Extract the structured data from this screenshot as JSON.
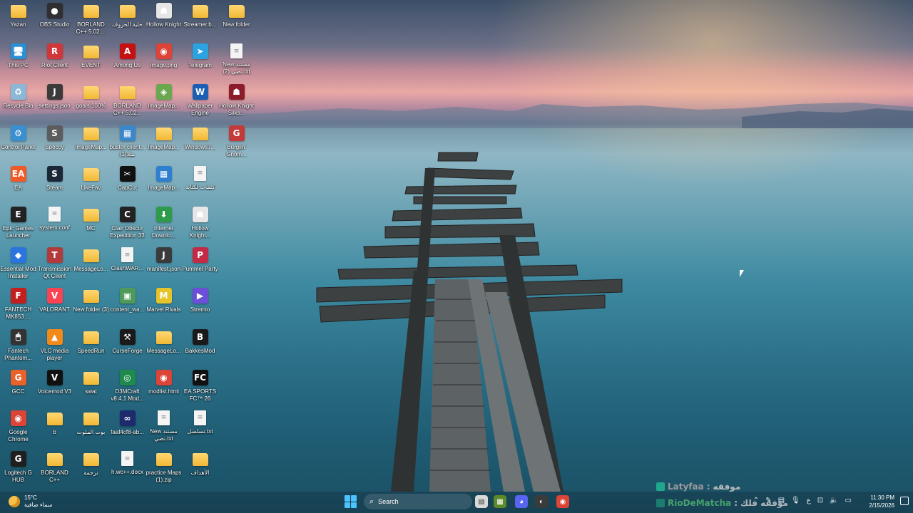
{
  "desktop": {
    "icons": [
      {
        "label": "Yazan",
        "kind": "folder"
      },
      {
        "label": "This PC",
        "kind": "app",
        "color": "#2b8fd6",
        "glyph": "🖥"
      },
      {
        "label": "Recycle Bin",
        "kind": "app",
        "color": "#8cb7d6",
        "glyph": "♻"
      },
      {
        "label": "Control Panel",
        "kind": "app",
        "color": "#3a8fd0",
        "glyph": "⚙"
      },
      {
        "label": "EA",
        "kind": "app",
        "color": "#f05a28",
        "glyph": "EA"
      },
      {
        "label": "Epic Games Launcher",
        "kind": "app",
        "color": "#222222",
        "glyph": "E"
      },
      {
        "label": "Essential Mod Installer",
        "kind": "app",
        "color": "#2a74e0",
        "glyph": "◆"
      },
      {
        "label": "FANTECH MK853 ...",
        "kind": "app",
        "color": "#c41f1f",
        "glyph": "F"
      },
      {
        "label": "Fantech Phantom...",
        "kind": "app",
        "color": "#333333",
        "glyph": "🖱"
      },
      {
        "label": "GCC",
        "kind": "app",
        "color": "#e8622a",
        "glyph": "G"
      },
      {
        "label": "Google Chrome",
        "kind": "app",
        "color": "#db4437",
        "glyph": "◉"
      },
      {
        "label": "Logitech G HUB",
        "kind": "app",
        "color": "#1f1f1f",
        "glyph": "G"
      },
      {
        "label": "OBS Studio",
        "kind": "app",
        "color": "#302e31",
        "glyph": "●"
      },
      {
        "label": "Riot Client",
        "kind": "app",
        "color": "#d13639",
        "glyph": "R"
      },
      {
        "label": "settings.json",
        "kind": "app",
        "color": "#3b3b3b",
        "glyph": "J"
      },
      {
        "label": "Speccy",
        "kind": "app",
        "color": "#5c5c5c",
        "glyph": "S"
      },
      {
        "label": "Steam",
        "kind": "app",
        "color": "#1b2838",
        "glyph": "S"
      },
      {
        "label": "system.conf",
        "kind": "file"
      },
      {
        "label": "Transmission Qt Client",
        "kind": "app",
        "color": "#b23a3a",
        "glyph": "T"
      },
      {
        "label": "VALORANT",
        "kind": "app",
        "color": "#fa4454",
        "glyph": "V"
      },
      {
        "label": "VLC media player",
        "kind": "app",
        "color": "#f28a1a",
        "glyph": "▲"
      },
      {
        "label": "Voicemod V3",
        "kind": "app",
        "color": "#111111",
        "glyph": "V"
      },
      {
        "label": "b",
        "kind": "folder"
      },
      {
        "label": "BORLAND C++",
        "kind": "folder"
      },
      {
        "label": "BORLAND C++ 5.02 ...",
        "kind": "folder"
      },
      {
        "label": "EVENT",
        "kind": "folder"
      },
      {
        "label": "goals 100%",
        "kind": "folder"
      },
      {
        "label": "ImageMap...",
        "kind": "folder"
      },
      {
        "label": "LikeFav",
        "kind": "folder"
      },
      {
        "label": "MC",
        "kind": "folder"
      },
      {
        "label": "MessageLo...",
        "kind": "folder"
      },
      {
        "label": "New folder (3)",
        "kind": "folder"
      },
      {
        "label": "SpeedRun",
        "kind": "folder"
      },
      {
        "label": "swat",
        "kind": "folder"
      },
      {
        "label": "بوت الملوت",
        "kind": "folder"
      },
      {
        "label": "ترجمة",
        "kind": "folder"
      },
      {
        "label": "خلية الحروف",
        "kind": "folder"
      },
      {
        "label": "Among Us",
        "kind": "app",
        "color": "#c51111",
        "glyph": "A"
      },
      {
        "label": "BORLAND C++ 5.02...",
        "kind": "folder"
      },
      {
        "label": "buster client... مثلا(1)",
        "kind": "app",
        "color": "#3a87c9",
        "glyph": "▦"
      },
      {
        "label": "CapCut",
        "kind": "app",
        "color": "#111111",
        "glyph": "✂"
      },
      {
        "label": "Clair Obscur Expedition 33",
        "kind": "app",
        "color": "#222222",
        "glyph": "C"
      },
      {
        "label": "ClashWAR...",
        "kind": "file"
      },
      {
        "label": "content_wa...",
        "kind": "app",
        "color": "#4e9a59",
        "glyph": "▣"
      },
      {
        "label": "CurseForge",
        "kind": "app",
        "color": "#1a1a1a",
        "glyph": "⚒"
      },
      {
        "label": "D3MCraft v8.4.1 Mod...",
        "kind": "app",
        "color": "#1e8a4c",
        "glyph": "◎"
      },
      {
        "label": "faaf4cf8-ab...",
        "kind": "app",
        "color": "#1d2a6b",
        "glyph": "∞"
      },
      {
        "label": "h.wc++.docx",
        "kind": "file"
      },
      {
        "label": "Hollow Knight",
        "kind": "app",
        "color": "#e6e6e6",
        "glyph": "☗"
      },
      {
        "label": "image.png",
        "kind": "app",
        "color": "#db4437",
        "glyph": "◉"
      },
      {
        "label": "ImageMap...",
        "kind": "app",
        "color": "#6aa84f",
        "glyph": "◈"
      },
      {
        "label": "ImageMap...",
        "kind": "folder"
      },
      {
        "label": "ImageMap...",
        "kind": "app",
        "color": "#2f7fd0",
        "glyph": "▦"
      },
      {
        "label": "Internet Downlo...",
        "kind": "app",
        "color": "#2f9a4a",
        "glyph": "⬇"
      },
      {
        "label": "manifest.json",
        "kind": "app",
        "color": "#3b3b3b",
        "glyph": "J"
      },
      {
        "label": "Marvel Rivals",
        "kind": "app",
        "color": "#e5c42a",
        "glyph": "M"
      },
      {
        "label": "MessageLo...",
        "kind": "folder"
      },
      {
        "label": "modlist.html",
        "kind": "app",
        "color": "#db4437",
        "glyph": "◉"
      },
      {
        "label": "New مستند نصي.txt",
        "kind": "file"
      },
      {
        "label": "practice Maps (1).zip",
        "kind": "folder"
      },
      {
        "label": "Streamer.b...",
        "kind": "folder"
      },
      {
        "label": "Telegram",
        "kind": "app",
        "color": "#2aa3e0",
        "glyph": "➤"
      },
      {
        "label": "Wallpaper Engine",
        "kind": "app",
        "color": "#1a5fb4",
        "glyph": "W"
      },
      {
        "label": "Windows7...",
        "kind": "folder"
      },
      {
        "label": "كلمات لكتابة",
        "kind": "file"
      },
      {
        "label": "Hollow Knight...",
        "kind": "app",
        "color": "#e6e6e6",
        "glyph": "☗"
      },
      {
        "label": "Pummel Party",
        "kind": "app",
        "color": "#c42a45",
        "glyph": "P"
      },
      {
        "label": "Stremio",
        "kind": "app",
        "color": "#6b4fd8",
        "glyph": "▶"
      },
      {
        "label": "BakkesMod",
        "kind": "app",
        "color": "#1a1a1a",
        "glyph": "B"
      },
      {
        "label": "EA SPORTS FC™ 26",
        "kind": "app",
        "color": "#111111",
        "glyph": "FC"
      },
      {
        "label": "تسلسل.txt",
        "kind": "file"
      },
      {
        "label": "الأهداف",
        "kind": "folder"
      },
      {
        "label": "New folder",
        "kind": "folder"
      },
      {
        "label": "New مستند نصي (2).txt",
        "kind": "file"
      },
      {
        "label": "Hollow Knight Silks...",
        "kind": "app",
        "color": "#8c1c2a",
        "glyph": "☗"
      },
      {
        "label": "Burglin' Gnom...",
        "kind": "app",
        "color": "#c43a3a",
        "glyph": "G"
      }
    ]
  },
  "taskbar": {
    "weather": {
      "temp": "15°C",
      "desc": "سماء صافية"
    },
    "search_placeholder": "Search",
    "clock": {
      "time": "11:30 PM",
      "date": "2/15/2026"
    }
  },
  "overlay": {
    "line1": {
      "name": "Latyfaa",
      "sep": " : ",
      "text": "موفقه"
    },
    "line2": {
      "name": "RioDeMatcha",
      "sep": " : ",
      "text": "مؤفقه فلك"
    }
  },
  "colors": {
    "overlay_name1": "#9a9a9a",
    "overlay_name2": "#5fe08a",
    "accent": "#4cc2ff"
  }
}
